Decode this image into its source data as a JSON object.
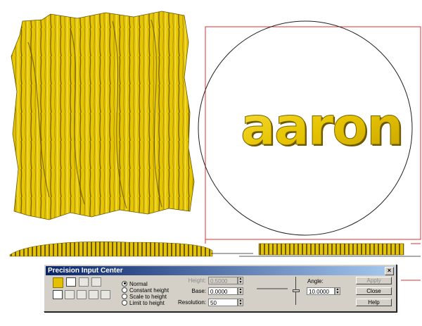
{
  "dialog": {
    "title": "Precision Input Center",
    "close_glyph": "×",
    "radios": [
      {
        "label": "Normal",
        "selected": true
      },
      {
        "label": "Constant height",
        "selected": false
      },
      {
        "label": "Scale to height",
        "selected": false
      },
      {
        "label": "Limit to height",
        "selected": false
      }
    ],
    "height_label": "Height:",
    "height_value": "0.5000",
    "base_label": "Base:",
    "base_value": "0.0000",
    "resolution_label": "Resolution:",
    "resolution_value": "50",
    "angle_label": "Angle:",
    "angle_value": "10.0000",
    "apply_label": "Apply",
    "close_label": "Close",
    "help_label": "Help"
  },
  "canvas": {
    "relief_text": "aaron",
    "colors": {
      "gold": "#e8c800",
      "gold_dark": "#8a7000",
      "selection_box": "#e03030",
      "circle": "#202020"
    }
  }
}
